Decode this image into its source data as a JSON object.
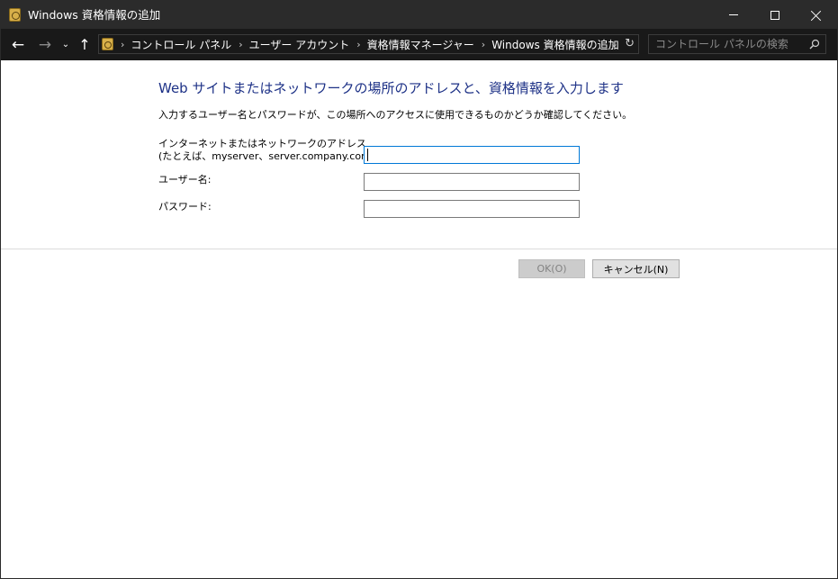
{
  "window": {
    "title": "Windows 資格情報の追加",
    "icon": "credential-manager-icon"
  },
  "nav": {
    "back_icon": "←",
    "forward_icon": "→",
    "recent_icon": "⌄",
    "up_icon": "↑"
  },
  "address": {
    "crumbs": [
      "コントロール パネル",
      "ユーザー アカウント",
      "資格情報マネージャー",
      "Windows 資格情報の追加"
    ],
    "separator": "›",
    "dropdown_icon": "⌄",
    "refresh_icon": "↻"
  },
  "search": {
    "placeholder": "コントロール パネルの検索"
  },
  "form": {
    "heading": "Web サイトまたはネットワークの場所のアドレスと、資格情報を入力します",
    "subtext": "入力するユーザー名とパスワードが、この場所へのアクセスに使用できるものかどうか確認してください。",
    "address_label_line1": "インターネットまたはネットワークのアドレス",
    "address_label_line2": "(たとえば、myserver、server.company.com):",
    "address_value": "",
    "user_label": "ユーザー名:",
    "user_value": "",
    "password_label": "パスワード:",
    "password_value": ""
  },
  "buttons": {
    "ok": "OK(O)",
    "cancel": "キャンセル(N)"
  },
  "colors": {
    "titlebar": "#2b2b2b",
    "navbar": "#191919",
    "heading": "#1e3287",
    "focus": "#0078d7"
  }
}
